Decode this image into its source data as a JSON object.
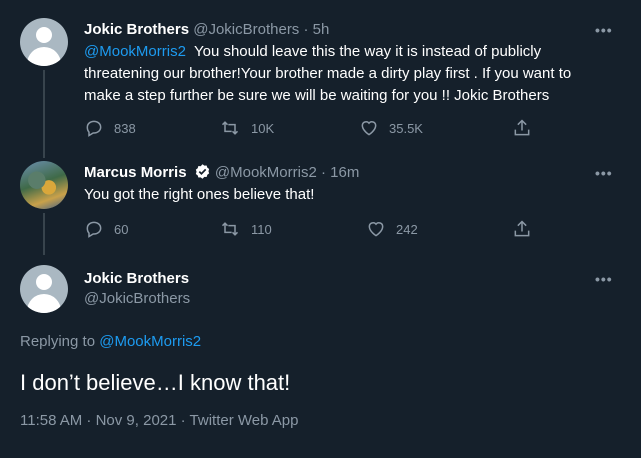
{
  "tweet1": {
    "name": "Jokic Brothers",
    "handle": "@JokicBrothers",
    "time": "· 5h",
    "mention": "@MookMorris2",
    "line1_rest": "  You should leave this the way it is instead of publicly",
    "line2": "threatening our brother!Your brother made a dirty play first . If you want to",
    "line3": "make a step further be sure we will be waiting for you !! Jokic Brothers",
    "replies": "838",
    "retweets": "10K",
    "likes": "35.5K",
    "more": "•••"
  },
  "tweet2": {
    "name": "Marcus Morris",
    "handle": "@MookMorris2",
    "time": "· 16m",
    "text": "You got the right ones believe that!",
    "replies": "60",
    "retweets": "110",
    "likes": "242",
    "more": "•••",
    "verified_color": "#ffffff"
  },
  "main_tweet": {
    "name": "Jokic Brothers",
    "handle": "@JokicBrothers",
    "replying_prefix": "Replying to ",
    "replying_to": "@MookMorris2",
    "text": "I don’t believe…I know that!",
    "meta": "11:58 AM · Nov 9, 2021 · Twitter Web App",
    "more": "•••"
  },
  "colors": {
    "background": "#15202b",
    "accent": "#1d9bf0",
    "muted": "#8b98a5"
  }
}
